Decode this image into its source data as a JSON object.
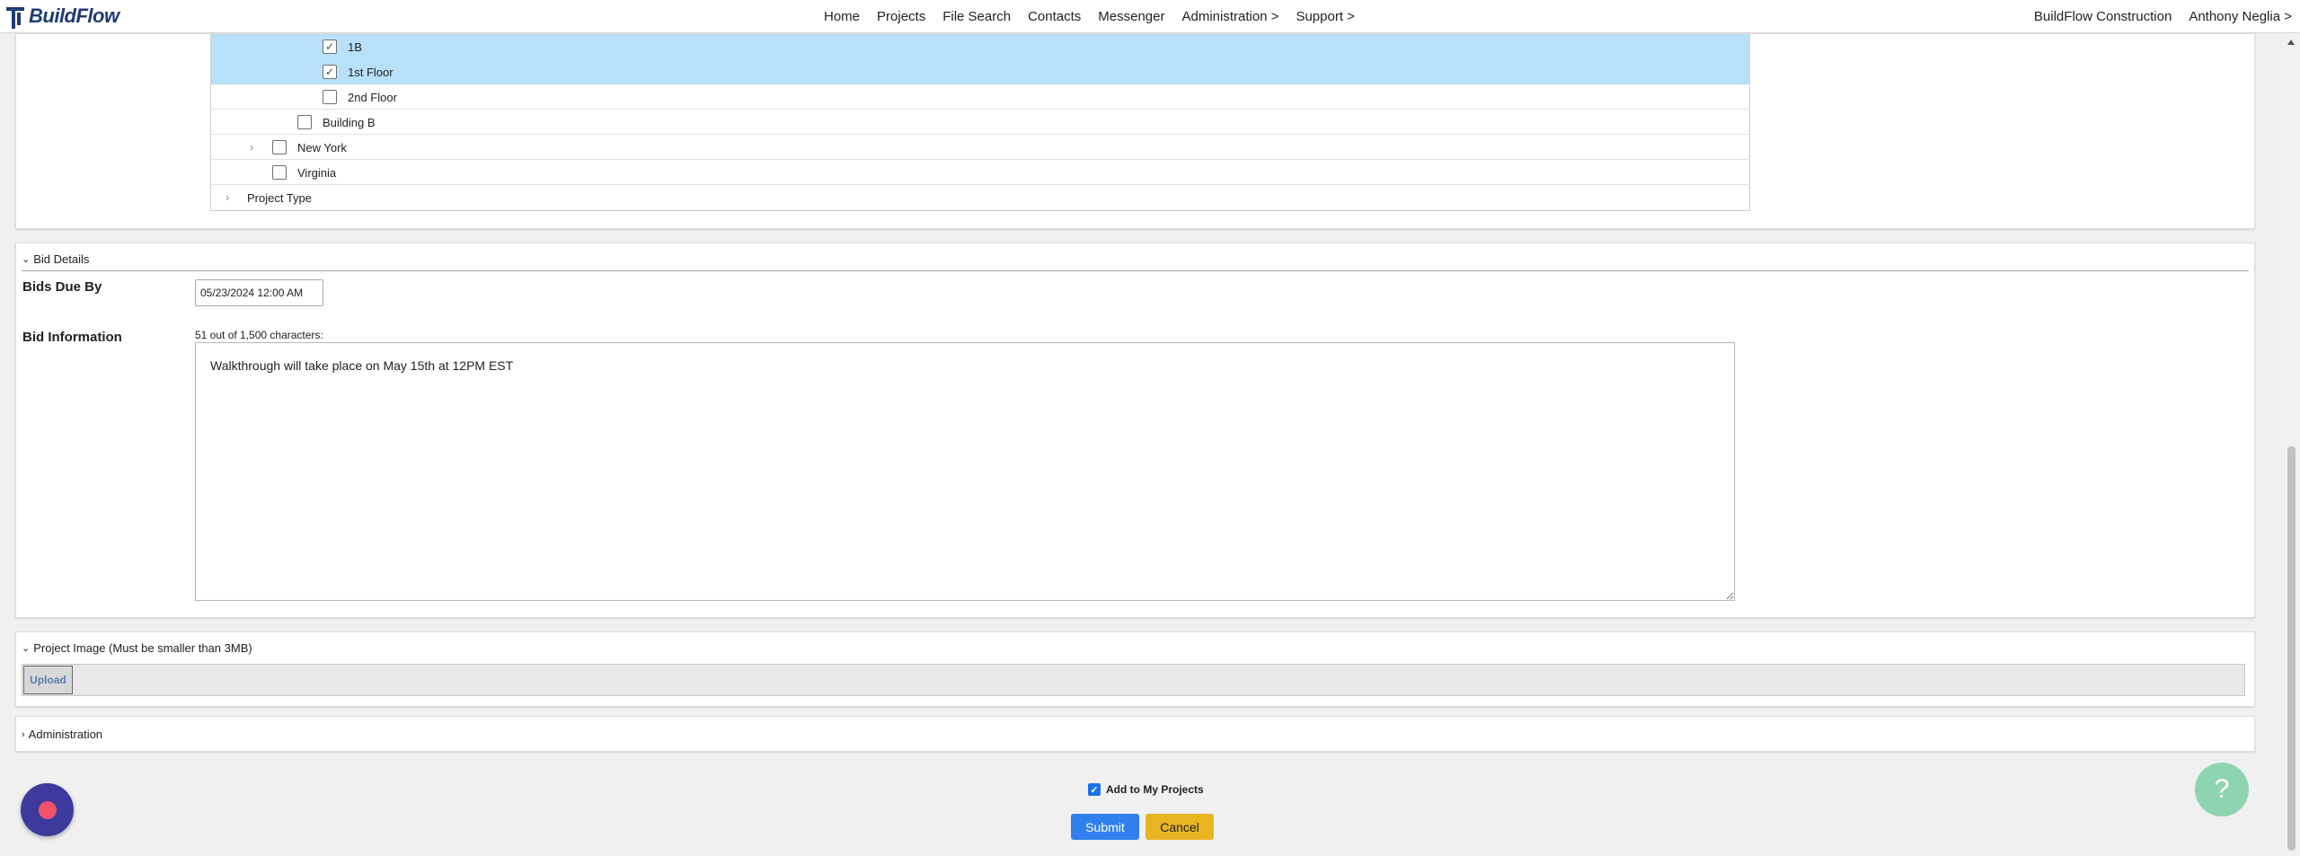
{
  "app": {
    "logo_text": "BuildFlow"
  },
  "nav": {
    "items": [
      "Home",
      "Projects",
      "File Search",
      "Contacts",
      "Messenger",
      "Administration >",
      "Support >"
    ],
    "company": "BuildFlow Construction",
    "user": "Anthony Neglia >"
  },
  "tree": {
    "rows": [
      {
        "label": "1B",
        "checked": true,
        "selected": true
      },
      {
        "label": "1st Floor",
        "checked": true,
        "selected": true
      },
      {
        "label": "2nd Floor",
        "checked": false,
        "selected": false
      },
      {
        "label": "Building B",
        "checked": false,
        "selected": false
      },
      {
        "label": "New York",
        "checked": false,
        "selected": false,
        "expandable": true
      },
      {
        "label": "Virginia",
        "checked": false,
        "selected": false
      },
      {
        "label": "Project Type",
        "expandable": true
      }
    ]
  },
  "bid_details": {
    "header": "Bid Details",
    "bids_due_label": "Bids Due By",
    "bids_due_value": "05/23/2024 12:00 AM",
    "bid_info_label": "Bid Information",
    "char_count": "51 out of 1,500 characters:",
    "bid_info_value": "Walkthrough will take place on May 15th at 12PM EST"
  },
  "project_image": {
    "header": "Project Image (Must be smaller than 3MB)",
    "upload_label": "Upload"
  },
  "administration": {
    "header": "Administration"
  },
  "footer": {
    "add_to_projects_label": "Add to My Projects",
    "add_to_projects_checked": true,
    "submit_label": "Submit",
    "cancel_label": "Cancel",
    "help_label": "?"
  }
}
